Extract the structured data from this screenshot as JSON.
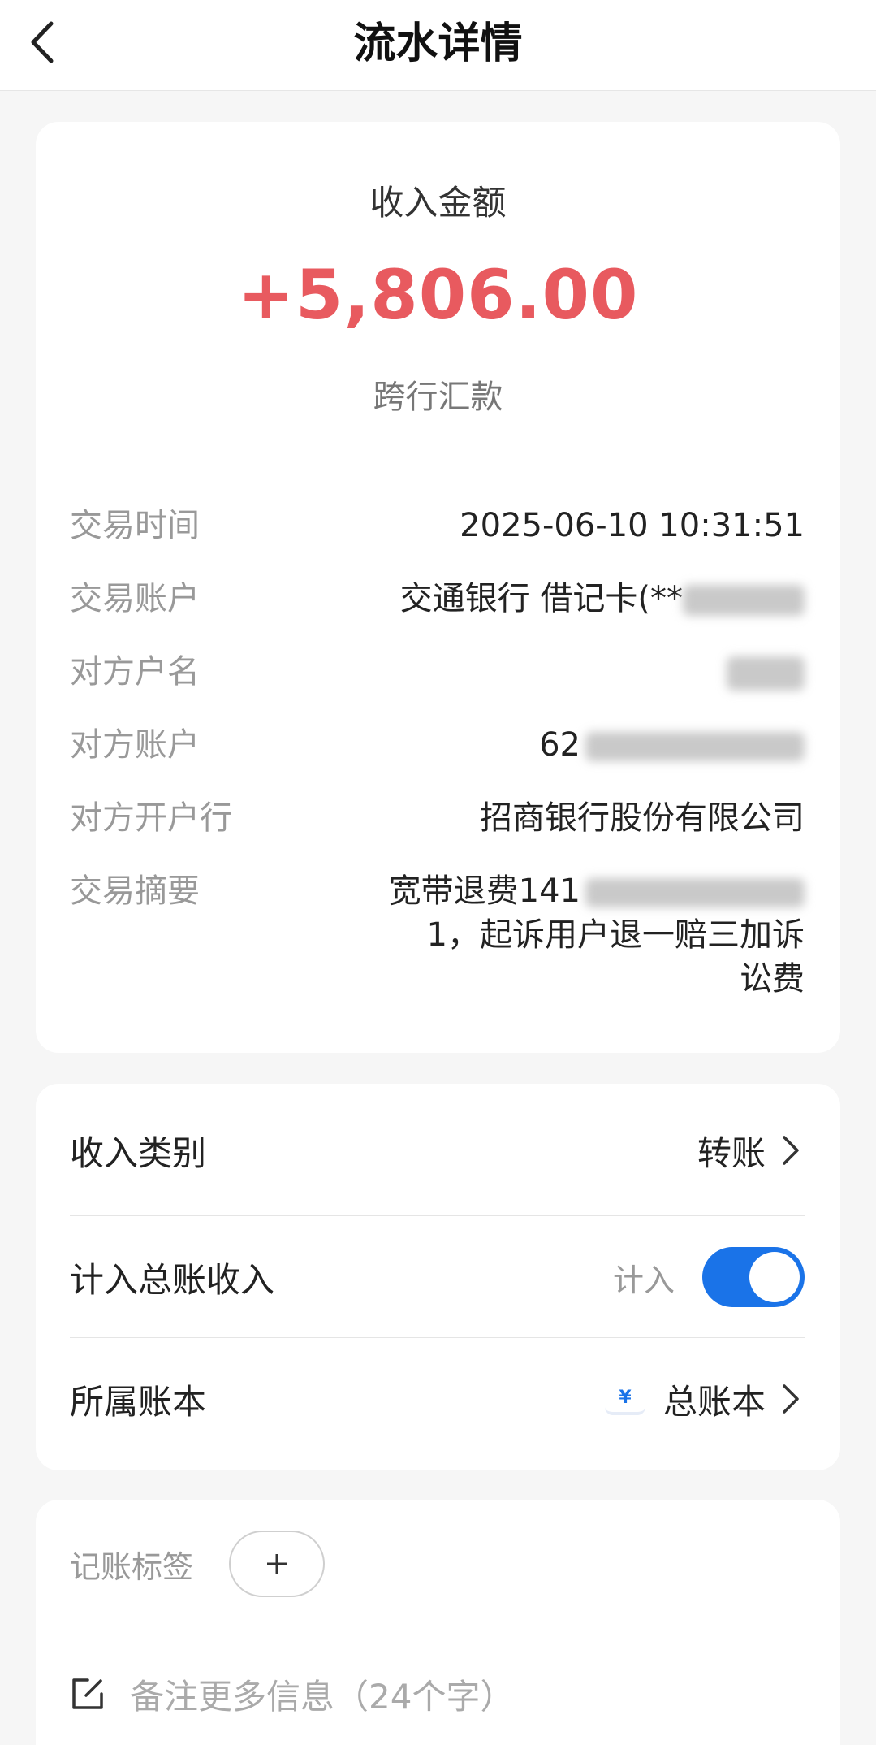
{
  "header": {
    "title": "流水详情"
  },
  "summary": {
    "amount_label": "收入金额",
    "amount": "+5,806.00",
    "type": "跨行汇款",
    "amount_color": "#e85a5f"
  },
  "details": {
    "time_label": "交易时间",
    "time_value": "2025-06-10 10:31:51",
    "account_label": "交易账户",
    "account_value": "交通银行 借记卡(**",
    "payee_name_label": "对方户名",
    "payee_account_label": "对方账户",
    "payee_account_value": "62",
    "payee_bank_label": "对方开户行",
    "payee_bank_value": "招商银行股份有限公司",
    "memo_label": "交易摘要",
    "memo_line1": "宽带退费141",
    "memo_line2": "1，起诉用户退一赔三加诉",
    "memo_line3": "讼费"
  },
  "settings": {
    "category_label": "收入类别",
    "category_value": "转账",
    "include_label": "计入总账收入",
    "include_state_label": "计入",
    "include_enabled": true,
    "book_label": "所属账本",
    "book_icon": "¥",
    "book_value": "总账本",
    "accent_color": "#1a73e8"
  },
  "extra": {
    "tag_label": "记账标签",
    "note_placeholder": "备注更多信息（24个字）"
  }
}
